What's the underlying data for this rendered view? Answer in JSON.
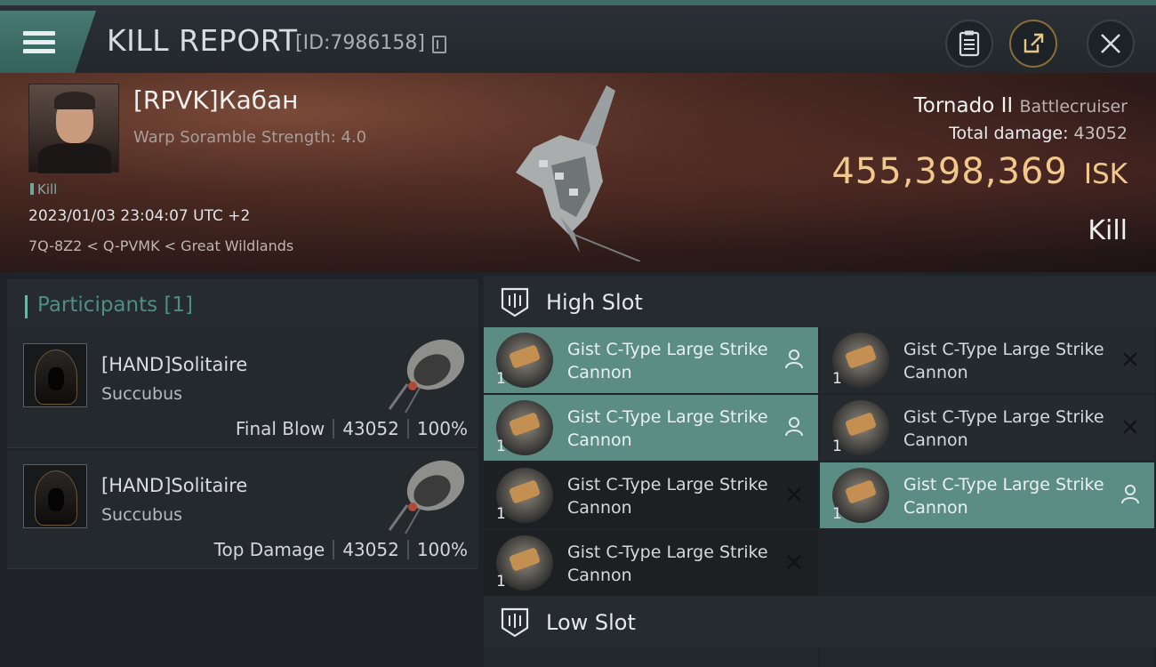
{
  "header": {
    "title": "KILL REPORT",
    "id_text": "[ID:7986158]"
  },
  "victim": {
    "name": "[RPVK]Кабан",
    "subtitle": "Warp Soramble Strength: 4.0",
    "tag": "Kill",
    "datetime": "2023/01/03 23:04:07 UTC +2",
    "location": "7Q-8Z2 < Q-PVMK < Great Wildlands",
    "ship_name": "Tornado II",
    "ship_class": "Battlecruiser",
    "damage_label": "Total damage:",
    "damage_value": "43052",
    "isk_value": "455,398,369",
    "isk_unit": "ISK",
    "result": "Kill"
  },
  "participants": {
    "header": "Participants [1]",
    "rows": [
      {
        "name": "[HAND]Solitaire",
        "ship": "Succubus",
        "role": "Final Blow",
        "damage": "43052",
        "percent": "100%"
      },
      {
        "name": "[HAND]Solitaire",
        "ship": "Succubus",
        "role": "Top Damage",
        "damage": "43052",
        "percent": "100%"
      }
    ]
  },
  "fitting": {
    "high_label": "High Slot",
    "low_label": "Low Slot",
    "modules": [
      {
        "name": "Gist C-Type Large Strike Cannon",
        "qty": "1",
        "status": "user-icon"
      },
      {
        "name": "Gist C-Type Large Strike Cannon",
        "qty": "1",
        "status": "x-icon"
      },
      {
        "name": "Gist C-Type Large Strike Cannon",
        "qty": "1",
        "status": "user-icon"
      },
      {
        "name": "Gist C-Type Large Strike Cannon",
        "qty": "1",
        "status": "x-icon"
      },
      {
        "name": "Gist C-Type Large Strike Cannon",
        "qty": "1",
        "status": "x-icon"
      },
      {
        "name": "Gist C-Type Large Strike Cannon",
        "qty": "1",
        "status": "user-icon"
      },
      {
        "name": "Gist C-Type Large Strike Cannon",
        "qty": "1",
        "status": "x-icon"
      }
    ]
  },
  "colors": {
    "accent": "#5c8d85",
    "isk": "#f2c98a",
    "participants_header": "#4f8d86"
  }
}
